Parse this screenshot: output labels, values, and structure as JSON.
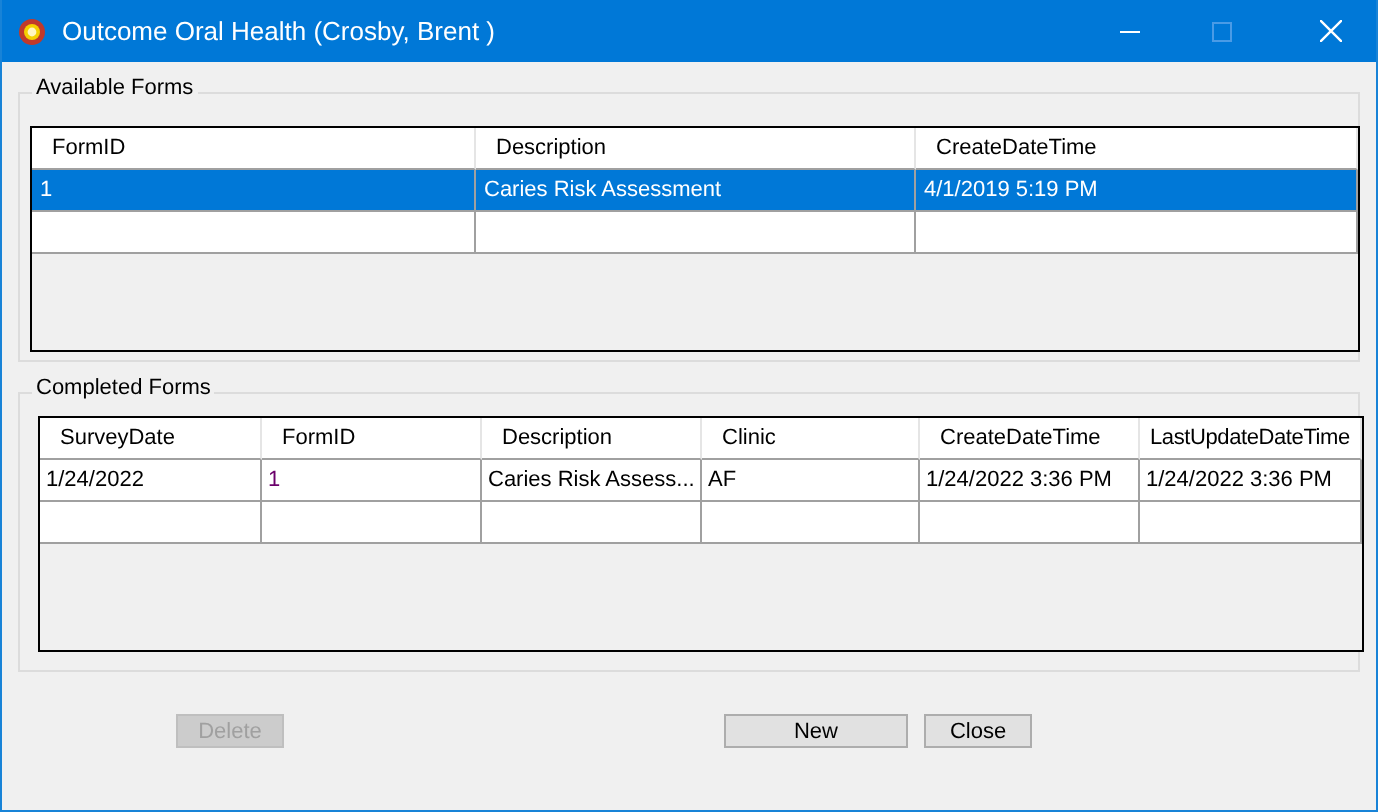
{
  "window": {
    "title": "Outcome Oral Health (Crosby, Brent )",
    "maximize_disabled": true
  },
  "available_forms": {
    "title": "Available Forms",
    "columns": [
      "FormID",
      "Description",
      "CreateDateTime"
    ],
    "rows": [
      {
        "cells": [
          "1",
          "Caries Risk Assessment",
          "4/1/2019 5:19 PM"
        ],
        "selected": true
      }
    ]
  },
  "completed_forms": {
    "title": "Completed Forms",
    "columns": [
      "SurveyDate",
      "FormID",
      "Description",
      "Clinic",
      "CreateDateTime",
      "LastUpdateDateTime"
    ],
    "rows": [
      {
        "cells": [
          "1/24/2022",
          "1",
          "Caries Risk Assess...",
          "AF",
          "1/24/2022 3:36 PM",
          "1/24/2022 3:36 PM"
        ],
        "selected": false
      }
    ]
  },
  "buttons": [
    {
      "label": "Delete",
      "disabled": true
    },
    {
      "label": "New",
      "disabled": false
    },
    {
      "label": "Close",
      "disabled": false
    }
  ]
}
